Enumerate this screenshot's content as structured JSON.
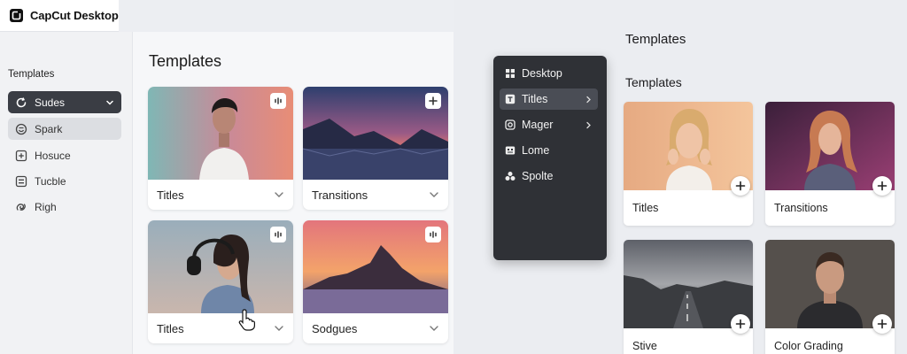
{
  "app": {
    "title": "CapCut Desktop"
  },
  "sidebar": {
    "heading": "Templates",
    "items": [
      {
        "label": "Sudes",
        "icon": "circle-refresh-icon",
        "state": "selected"
      },
      {
        "label": "Spark",
        "icon": "smile-circle-icon",
        "state": "hover"
      },
      {
        "label": "Hosuce",
        "icon": "plus-square-icon",
        "state": "normal"
      },
      {
        "label": "Tucble",
        "icon": "list-square-icon",
        "state": "normal"
      },
      {
        "label": "Righ",
        "icon": "swirl-icon",
        "state": "normal"
      }
    ]
  },
  "main": {
    "title": "Templates",
    "cards": [
      {
        "label": "Titles",
        "badge": "audio-bars-icon"
      },
      {
        "label": "Transitions",
        "badge": "plus-icon"
      },
      {
        "label": "Titles",
        "badge": "audio-bars-icon"
      },
      {
        "label": "Sodgues",
        "badge": "audio-bars-icon"
      }
    ]
  },
  "menu": {
    "items": [
      {
        "label": "Desktop",
        "icon": "grid-icon",
        "active": false,
        "submenu": false
      },
      {
        "label": "Titles",
        "icon": "text-icon",
        "active": true,
        "submenu": true
      },
      {
        "label": "Mager",
        "icon": "camera-icon",
        "active": false,
        "submenu": true
      },
      {
        "label": "Lome",
        "icon": "caption-icon",
        "active": false,
        "submenu": false
      },
      {
        "label": "Spolte",
        "icon": "shapes-icon",
        "active": false,
        "submenu": false
      }
    ]
  },
  "right": {
    "title": "Templates",
    "subtitle": "Templates",
    "cards": [
      {
        "label": "Titles"
      },
      {
        "label": "Transitions"
      },
      {
        "label": "Stive"
      },
      {
        "label": "Color Grading"
      }
    ]
  },
  "colors": {
    "sidebar_selected": "#3a3d44",
    "menu_bg": "#2f3136",
    "menu_active": "#4a4d55"
  }
}
